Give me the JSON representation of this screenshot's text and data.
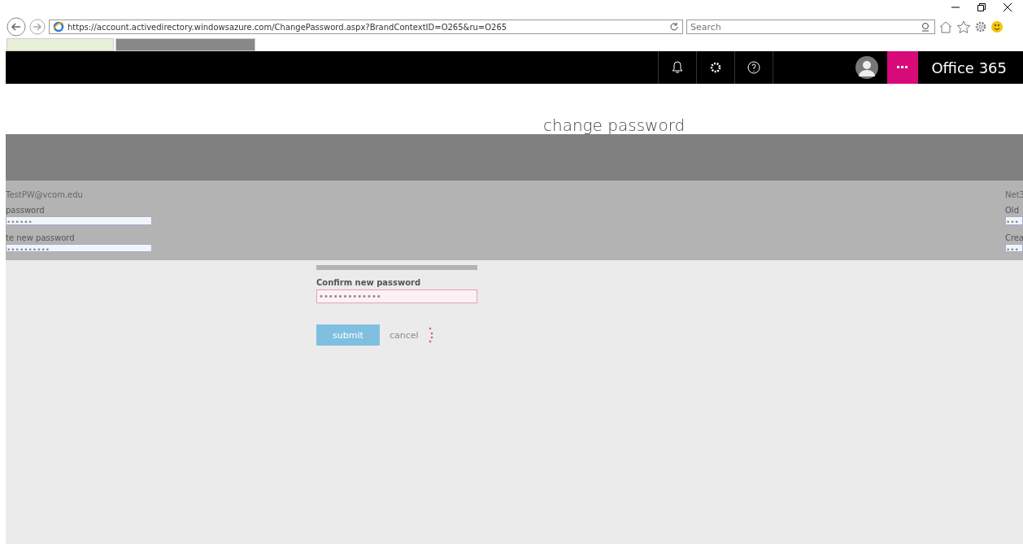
{
  "browser": {
    "url": "https://account.activedirectory.windowsazure.com/ChangePassword.aspx?BrandContextID=O265&ru=O265",
    "search": {
      "placeholder": "Search"
    }
  },
  "app_bar": {
    "brand": "Office 365"
  },
  "heading": "change password",
  "overlay": {
    "left": {
      "account": "TestPW@vcom.edu",
      "fields": [
        {
          "label": "password",
          "value": "••••••"
        },
        {
          "label": "te new password",
          "value": "••••••••••"
        }
      ]
    },
    "right": {
      "account": "Net3",
      "fields": [
        {
          "label": "Old",
          "value": "•••"
        },
        {
          "label": "Crea",
          "value": "•••"
        }
      ]
    }
  },
  "confirm": {
    "label": "Confirm new password",
    "value": "•••••••••••••"
  },
  "buttons": {
    "submit": "submit",
    "cancel": "cancel"
  }
}
